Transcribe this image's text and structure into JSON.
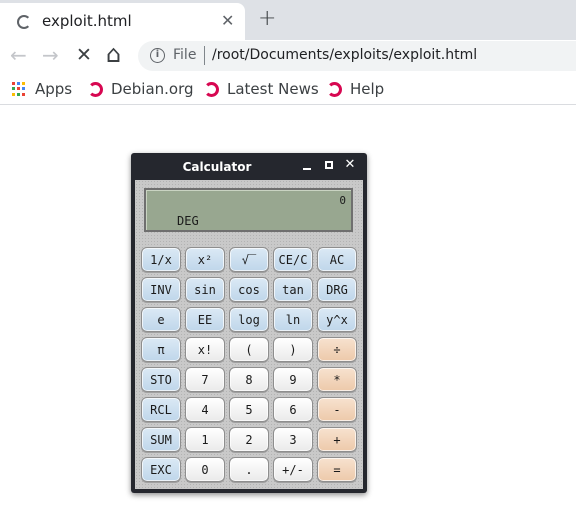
{
  "browser": {
    "tab_title": "exploit.html",
    "tab_close": "✕",
    "new_tab": "+",
    "scheme": "File",
    "url": "/root/Documents/exploits/exploit.html"
  },
  "nav": {
    "back": "←",
    "forward": "→",
    "stop": "✕",
    "home": "⌂",
    "info": "i"
  },
  "bookmarks": [
    {
      "label": "Apps",
      "icon": "apps-grid-icon"
    },
    {
      "label": "Debian.org",
      "icon": "debian-swirl-icon"
    },
    {
      "label": "Latest News",
      "icon": "debian-swirl-icon"
    },
    {
      "label": "Help",
      "icon": "debian-swirl-icon"
    }
  ],
  "calculator": {
    "title": "Calculator",
    "window_controls": {
      "minimize": "minimize-icon",
      "maximize": "maximize-icon",
      "close": "✕"
    },
    "display": {
      "value": "0",
      "mode": "DEG"
    },
    "keys": [
      [
        "1/x",
        "x²",
        "√‾",
        "CE/C",
        "AC"
      ],
      [
        "INV",
        "sin",
        "cos",
        "tan",
        "DRG"
      ],
      [
        "e",
        "EE",
        "log",
        "ln",
        "y^x"
      ],
      [
        "π",
        "x!",
        "(",
        ")",
        "÷"
      ],
      [
        "STO",
        "7",
        "8",
        "9",
        "*"
      ],
      [
        "RCL",
        "4",
        "5",
        "6",
        "-"
      ],
      [
        "SUM",
        "1",
        "2",
        "3",
        "+"
      ],
      [
        "EXC",
        "0",
        ".",
        "+/-",
        "="
      ]
    ],
    "key_colors": {
      "function": "#c8dcee",
      "digit": "#f4f4f4",
      "operator": "#f2d5bb"
    }
  }
}
